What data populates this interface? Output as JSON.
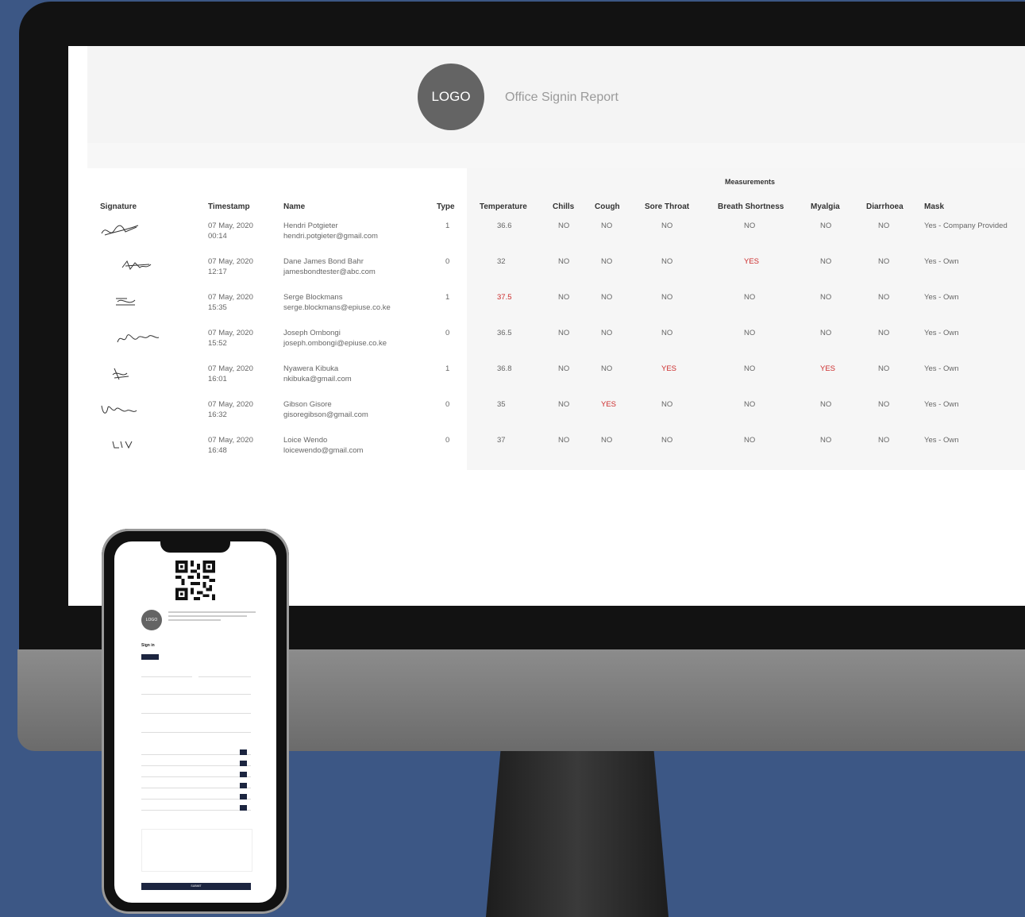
{
  "report": {
    "logo": "LOGO",
    "title": "Office Signin Report",
    "measurements_header": "Measurements",
    "columns": [
      "Signature",
      "Timestamp",
      "Name",
      "Type",
      "Temperature",
      "Chills",
      "Cough",
      "Sore Throat",
      "Breath Shortness",
      "Myalgia",
      "Diarrhoea",
      "Mask"
    ],
    "rows": [
      {
        "date": "07 May, 2020",
        "time": "00:14",
        "name": "Hendri Potgieter",
        "email": "hendri.potgieter@gmail.com",
        "type": "1",
        "temperature": "36.6",
        "chills": "NO",
        "cough": "NO",
        "sore_throat": "NO",
        "breath": "NO",
        "myalgia": "NO",
        "diarrhoea": "NO",
        "mask": "Yes - Company Provided"
      },
      {
        "date": "07 May, 2020",
        "time": "12:17",
        "name": "Dane James Bond Bahr",
        "email": "jamesbondtester@abc.com",
        "type": "0",
        "temperature": "32",
        "chills": "NO",
        "cough": "NO",
        "sore_throat": "NO",
        "breath": "YES",
        "myalgia": "NO",
        "diarrhoea": "NO",
        "mask": "Yes - Own"
      },
      {
        "date": "07 May, 2020",
        "time": "15:35",
        "name": "Serge Blockmans",
        "email": "serge.blockmans@epiuse.co.ke",
        "type": "1",
        "temperature": "37.5",
        "chills": "NO",
        "cough": "NO",
        "sore_throat": "NO",
        "breath": "NO",
        "myalgia": "NO",
        "diarrhoea": "NO",
        "mask": "Yes - Own"
      },
      {
        "date": "07 May, 2020",
        "time": "15:52",
        "name": "Joseph Ombongi",
        "email": "joseph.ombongi@epiuse.co.ke",
        "type": "0",
        "temperature": "36.5",
        "chills": "NO",
        "cough": "NO",
        "sore_throat": "NO",
        "breath": "NO",
        "myalgia": "NO",
        "diarrhoea": "NO",
        "mask": "Yes - Own"
      },
      {
        "date": "07 May, 2020",
        "time": "16:01",
        "name": "Nyawera Kibuka",
        "email": "nkibuka@gmail.com",
        "type": "1",
        "temperature": "36.8",
        "chills": "NO",
        "cough": "NO",
        "sore_throat": "YES",
        "breath": "NO",
        "myalgia": "YES",
        "diarrhoea": "NO",
        "mask": "Yes - Own"
      },
      {
        "date": "07 May, 2020",
        "time": "16:32",
        "name": "Gibson Gisore",
        "email": "gisoregibson@gmail.com",
        "type": "0",
        "temperature": "35",
        "chills": "NO",
        "cough": "YES",
        "sore_throat": "NO",
        "breath": "NO",
        "myalgia": "NO",
        "diarrhoea": "NO",
        "mask": "Yes - Own"
      },
      {
        "date": "07 May, 2020",
        "time": "16:48",
        "name": "Loice Wendo",
        "email": "loicewendo@gmail.com",
        "type": "0",
        "temperature": "37",
        "chills": "NO",
        "cough": "NO",
        "sore_throat": "NO",
        "breath": "NO",
        "myalgia": "NO",
        "diarrhoea": "NO",
        "mask": "Yes - Own"
      }
    ],
    "highlight_color": "#cc2b2b"
  },
  "mobile": {
    "logo": "LOGO",
    "signin_label": "Sign in",
    "submit_label": "SUBMIT"
  }
}
